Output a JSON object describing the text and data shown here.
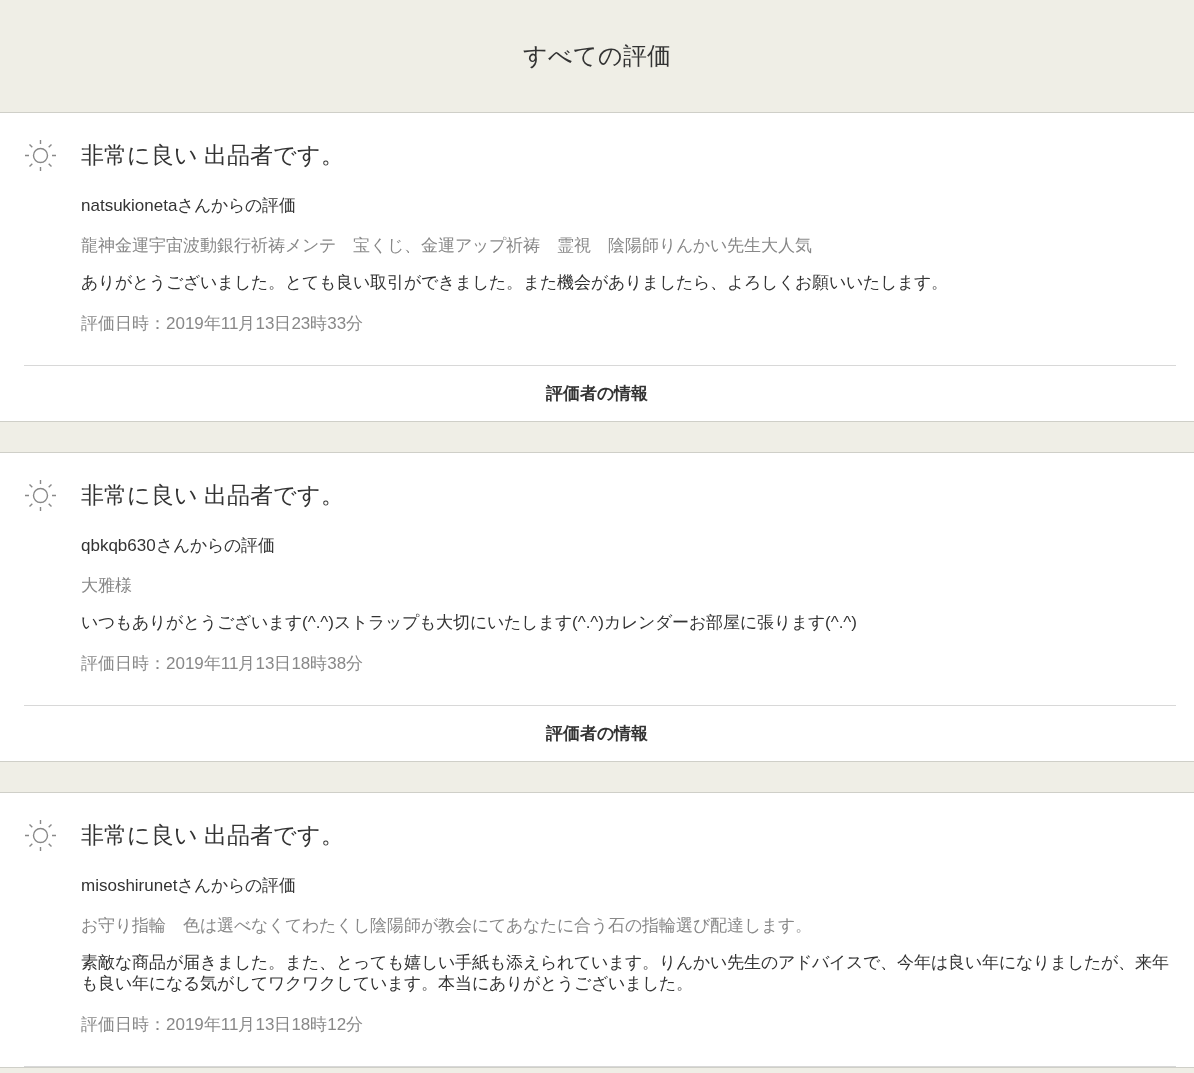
{
  "header": {
    "title": "すべての評価"
  },
  "reviews": [
    {
      "rating": "非常に良い 出品者です。",
      "reviewer": "natsukionetaさんからの評価",
      "item": "龍神金運宇宙波動銀行祈祷メンテ　宝くじ、金運アップ祈祷　霊視　陰陽師りんかい先生大人気",
      "comment": "ありがとうございました。とても良い取引ができました。また機会がありましたら、よろしくお願いいたします。",
      "date": "評価日時：2019年11月13日23時33分",
      "info_button": "評価者の情報"
    },
    {
      "rating": "非常に良い 出品者です。",
      "reviewer": "qbkqb630さんからの評価",
      "item": "大雅様",
      "comment": "いつもありがとうございます(^.^)ストラップも大切にいたします(^.^)カレンダーお部屋に張ります(^.^)",
      "date": "評価日時：2019年11月13日18時38分",
      "info_button": "評価者の情報"
    },
    {
      "rating": "非常に良い 出品者です。",
      "reviewer": "misoshirunetさんからの評価",
      "item": "お守り指輪　色は選べなくてわたくし陰陽師が教会にてあなたに合う石の指輪選び配達します。",
      "comment": "素敵な商品が届きました。また、とっても嬉しい手紙も添えられています。りんかい先生のアドバイスで、今年は良い年になりましたが、来年も良い年になる気がしてワクワクしています。本当にありがとうございました。",
      "date": "評価日時：2019年11月13日18時12分"
    }
  ]
}
